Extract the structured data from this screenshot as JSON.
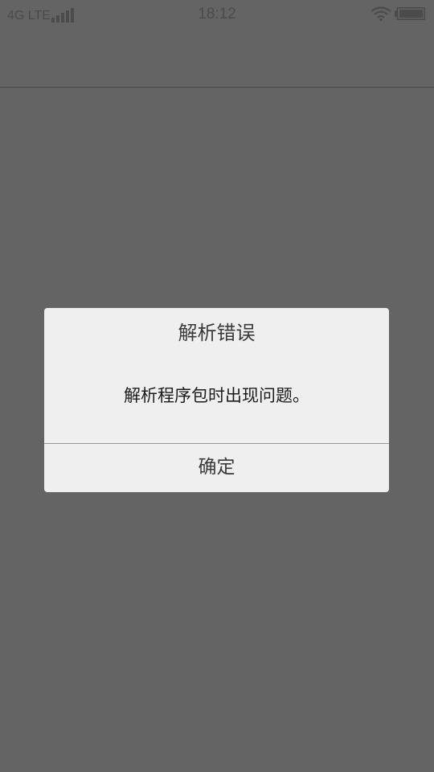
{
  "status_bar": {
    "carrier": "4G LTE",
    "time": "18:12",
    "icons": [
      "signal-icon",
      "wifi-icon",
      "battery-icon"
    ]
  },
  "dialog": {
    "title": "解析错误",
    "message": "解析程序包时出现问题。",
    "confirm_label": "确定"
  },
  "colors": {
    "dim_overlay": "#646464",
    "dialog_background": "#efefef",
    "divider": "#9a9a9a"
  }
}
